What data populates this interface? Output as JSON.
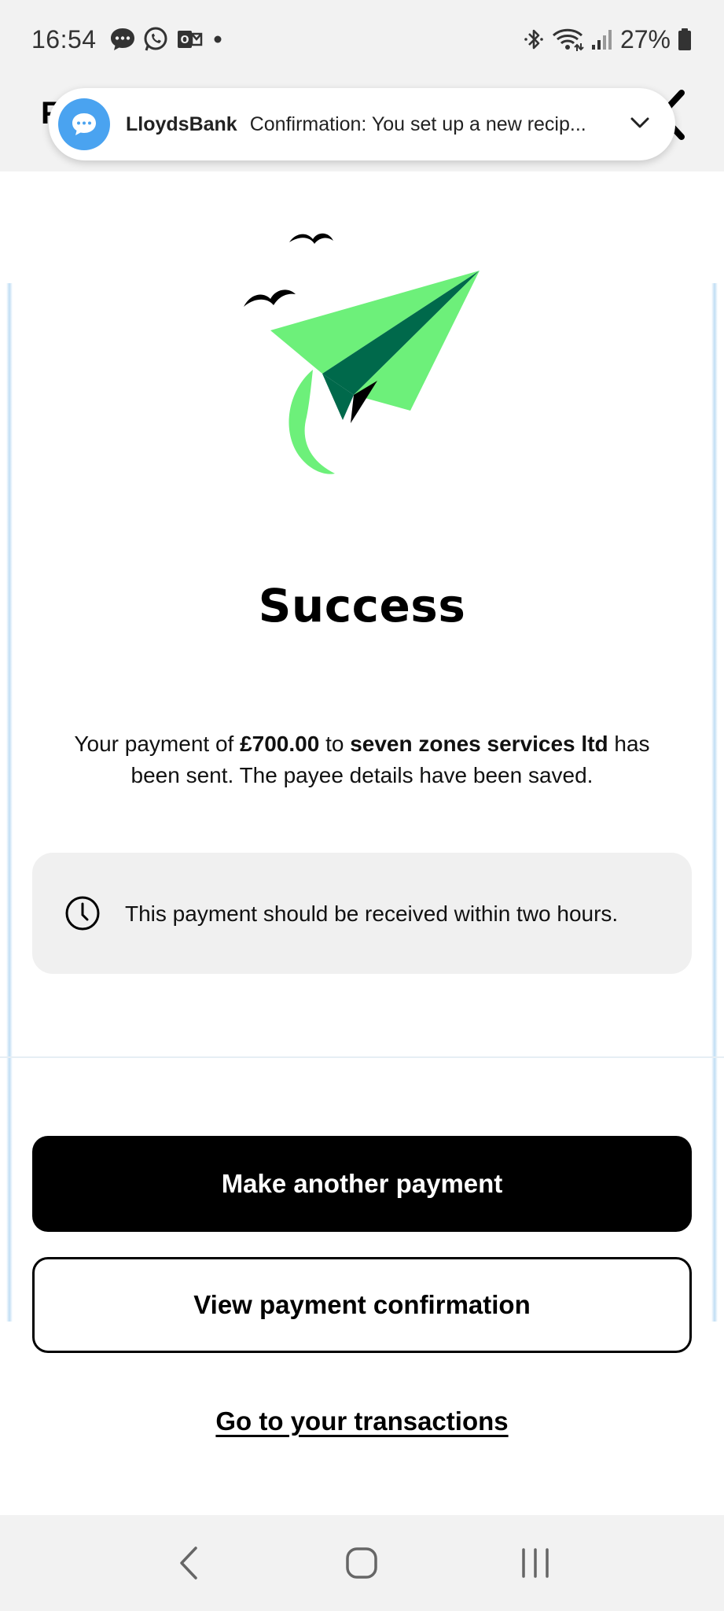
{
  "status_bar": {
    "time": "16:54",
    "battery": "27%",
    "icons_left": [
      "messages-icon",
      "whatsapp-icon",
      "outlook-icon",
      "dot-icon"
    ],
    "icons_right": [
      "bluetooth-icon",
      "wifi-icon",
      "signal-icon",
      "battery-icon"
    ]
  },
  "header": {
    "back_partial": "F"
  },
  "notification": {
    "app": "LloydsBank",
    "text": "Confirmation: You set up a new recip...",
    "icon": "chat-bubble-icon",
    "accent": "#4aa3f0"
  },
  "illustration": {
    "name": "paper-plane-illustration",
    "colors": {
      "light_green": "#6df07a",
      "dark_green": "#00694b",
      "black": "#000000"
    }
  },
  "main": {
    "title": "Success",
    "message": {
      "prefix": "Your payment of ",
      "amount": "£700.00",
      "middle": " to ",
      "payee": "seven zones services ltd",
      "suffix": " has been sent. The payee details have been saved."
    },
    "info": "This payment should be received within two hours."
  },
  "actions": {
    "primary": "Make another payment",
    "secondary": "View payment confirmation",
    "link": "Go to your transactions"
  },
  "nav_bar": {
    "back": "nav-back-icon",
    "home": "nav-home-icon",
    "recents": "nav-recents-icon"
  }
}
